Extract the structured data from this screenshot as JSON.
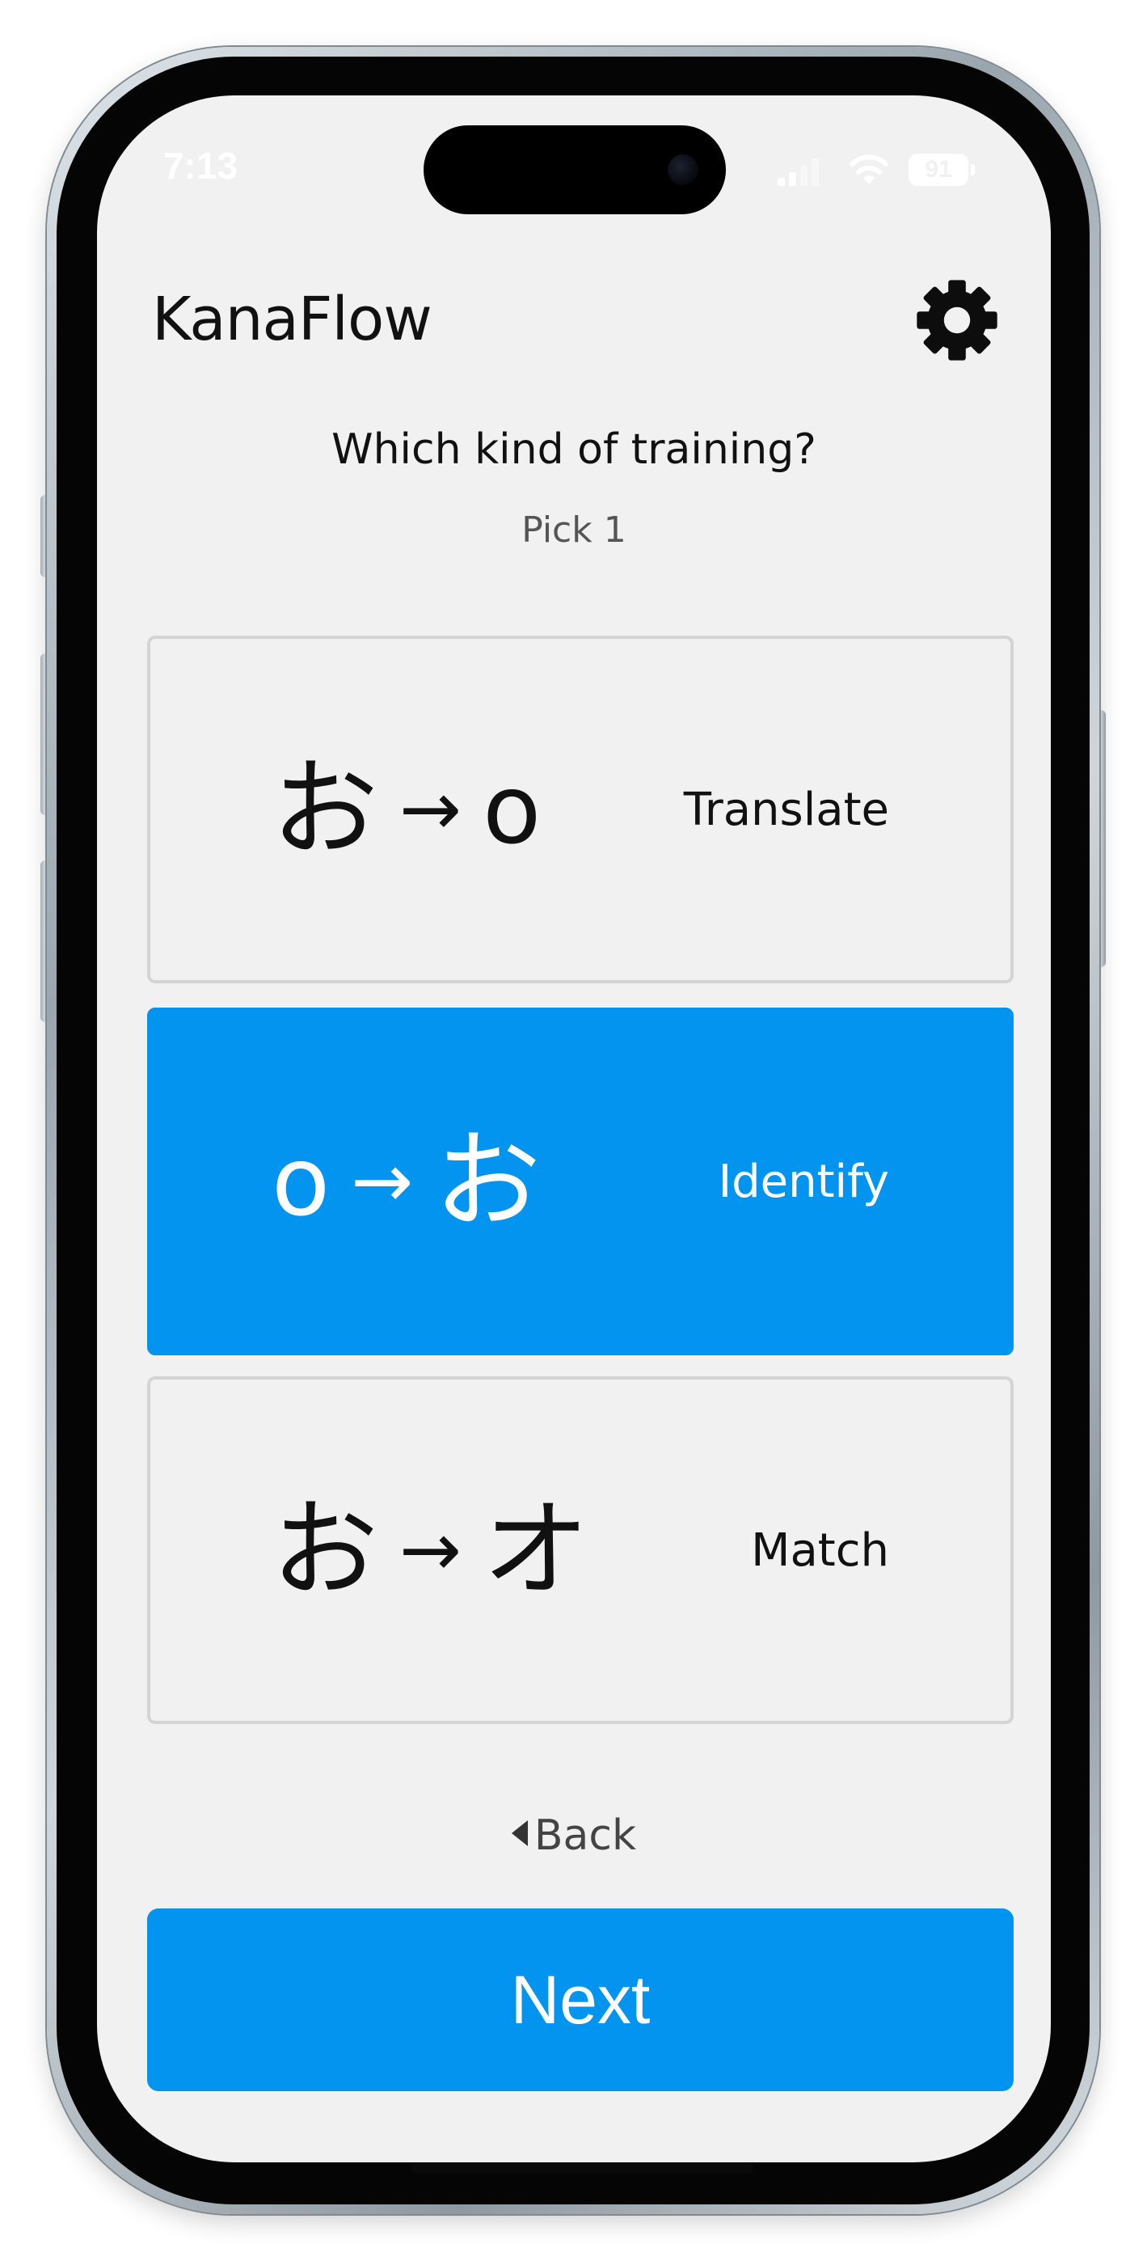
{
  "status_bar": {
    "time": "7:13",
    "battery": "91"
  },
  "header": {
    "title": "KanaFlow",
    "settings_icon": "gear-icon"
  },
  "prompt": {
    "question": "Which kind of training?",
    "subtitle": "Pick 1"
  },
  "options": [
    {
      "from": "お",
      "arrow": "→",
      "to": "o",
      "label": "Translate",
      "selected": false
    },
    {
      "from": "o",
      "arrow": "→",
      "to": "お",
      "label": "Identify",
      "selected": true
    },
    {
      "from": "お",
      "arrow": "→",
      "to": "オ",
      "label": "Match",
      "selected": false
    }
  ],
  "footer": {
    "back_label": "Back",
    "next_label": "Next"
  },
  "colors": {
    "accent": "#0294ee",
    "background": "#f1f1f1",
    "text": "#111111"
  }
}
